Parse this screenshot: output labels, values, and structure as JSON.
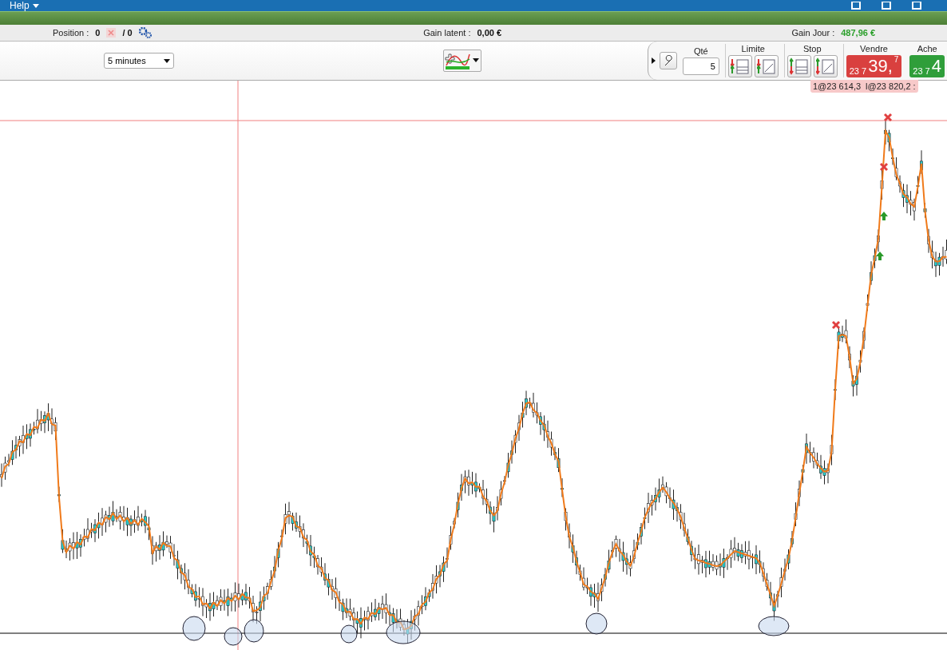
{
  "menu": {
    "label": "Help"
  },
  "status": {
    "position_label": "Position :",
    "position_value": "0",
    "orders_value": "/ 0",
    "gain_latent_label": "Gain latent :",
    "gain_latent_value": "0,00 €",
    "gain_jour_label": "Gain Jour :",
    "gain_jour_value": "487,96 €"
  },
  "toolbar": {
    "interval": "5 minutes"
  },
  "order_panel": {
    "qty_label": "Qté",
    "qty": "5",
    "limit_label": "Limite",
    "stop_label": "Stop",
    "sell": {
      "label": "Vendre",
      "prefix": "23 7",
      "main": "39,",
      "suffix": "7"
    },
    "buy": {
      "label": "Ache",
      "prefix": "23 7",
      "main": "4"
    },
    "pending": [
      "1@23 614,3",
      "l@23 820,2 :"
    ]
  }
}
